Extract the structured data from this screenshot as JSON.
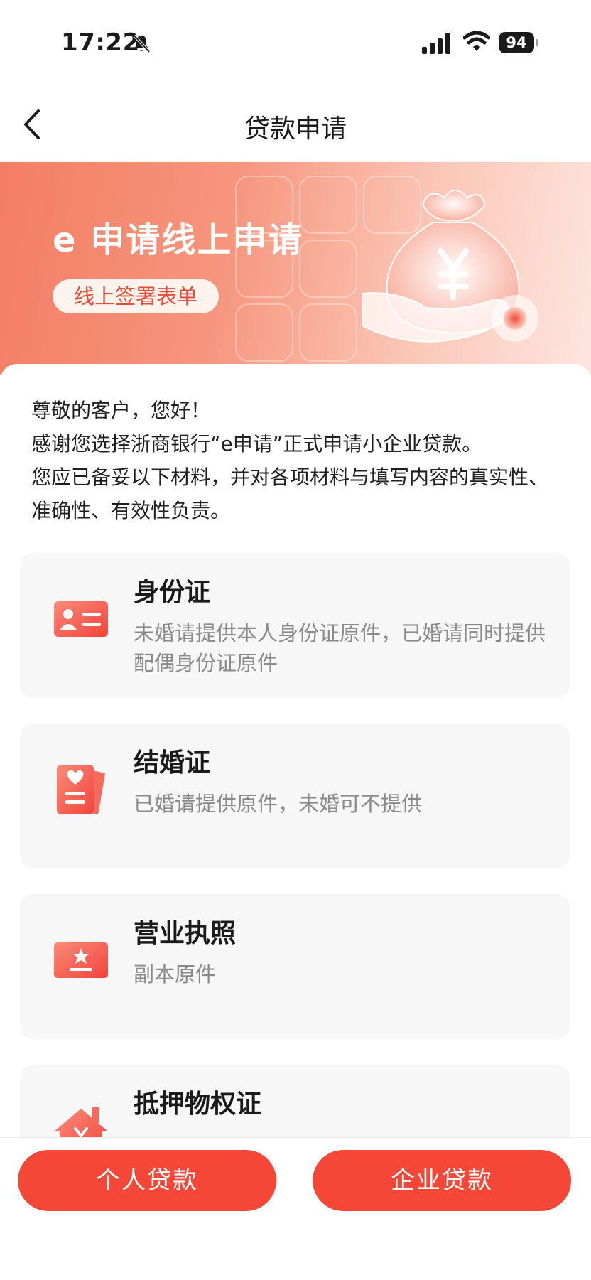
{
  "status_bar": {
    "time": "17:22",
    "battery": "94",
    "icons": [
      "bell-slash-icon",
      "cellular-signal-icon",
      "wifi-icon",
      "battery-icon"
    ]
  },
  "nav": {
    "title": "贷款申请",
    "back_icon": "chevron-left-icon"
  },
  "banner": {
    "title": "e 申请线上申请",
    "chip": "线上签署表单",
    "illustration": "money-bag-icon"
  },
  "intro": {
    "greeting": "尊敬的客户，您好！",
    "line1": "感谢您选择浙商银行“e申请”正式申请小企业贷款。",
    "line2": "您应已备妥以下材料，并对各项材料与填写内容的真实性、准确性、有效性负责。"
  },
  "materials": [
    {
      "title": "身份证",
      "desc": "未婚请提供本人身份证原件，已婚请同时提供配偶身份证原件",
      "icon": "id-card-icon"
    },
    {
      "title": "结婚证",
      "desc": "已婚请提供原件，未婚可不提供",
      "icon": "marriage-certificate-icon"
    },
    {
      "title": "营业执照",
      "desc": "副本原件",
      "icon": "business-license-icon"
    },
    {
      "title": "抵押物权证",
      "desc": "",
      "icon": "property-house-icon"
    }
  ],
  "buttons": {
    "personal": "个人贷款",
    "enterprise": "企业贷款"
  },
  "colors": {
    "accent": "#f44737",
    "banner_start": "#f47d64",
    "banner_end": "#fde6df",
    "card_bg": "#f7f7f7"
  }
}
